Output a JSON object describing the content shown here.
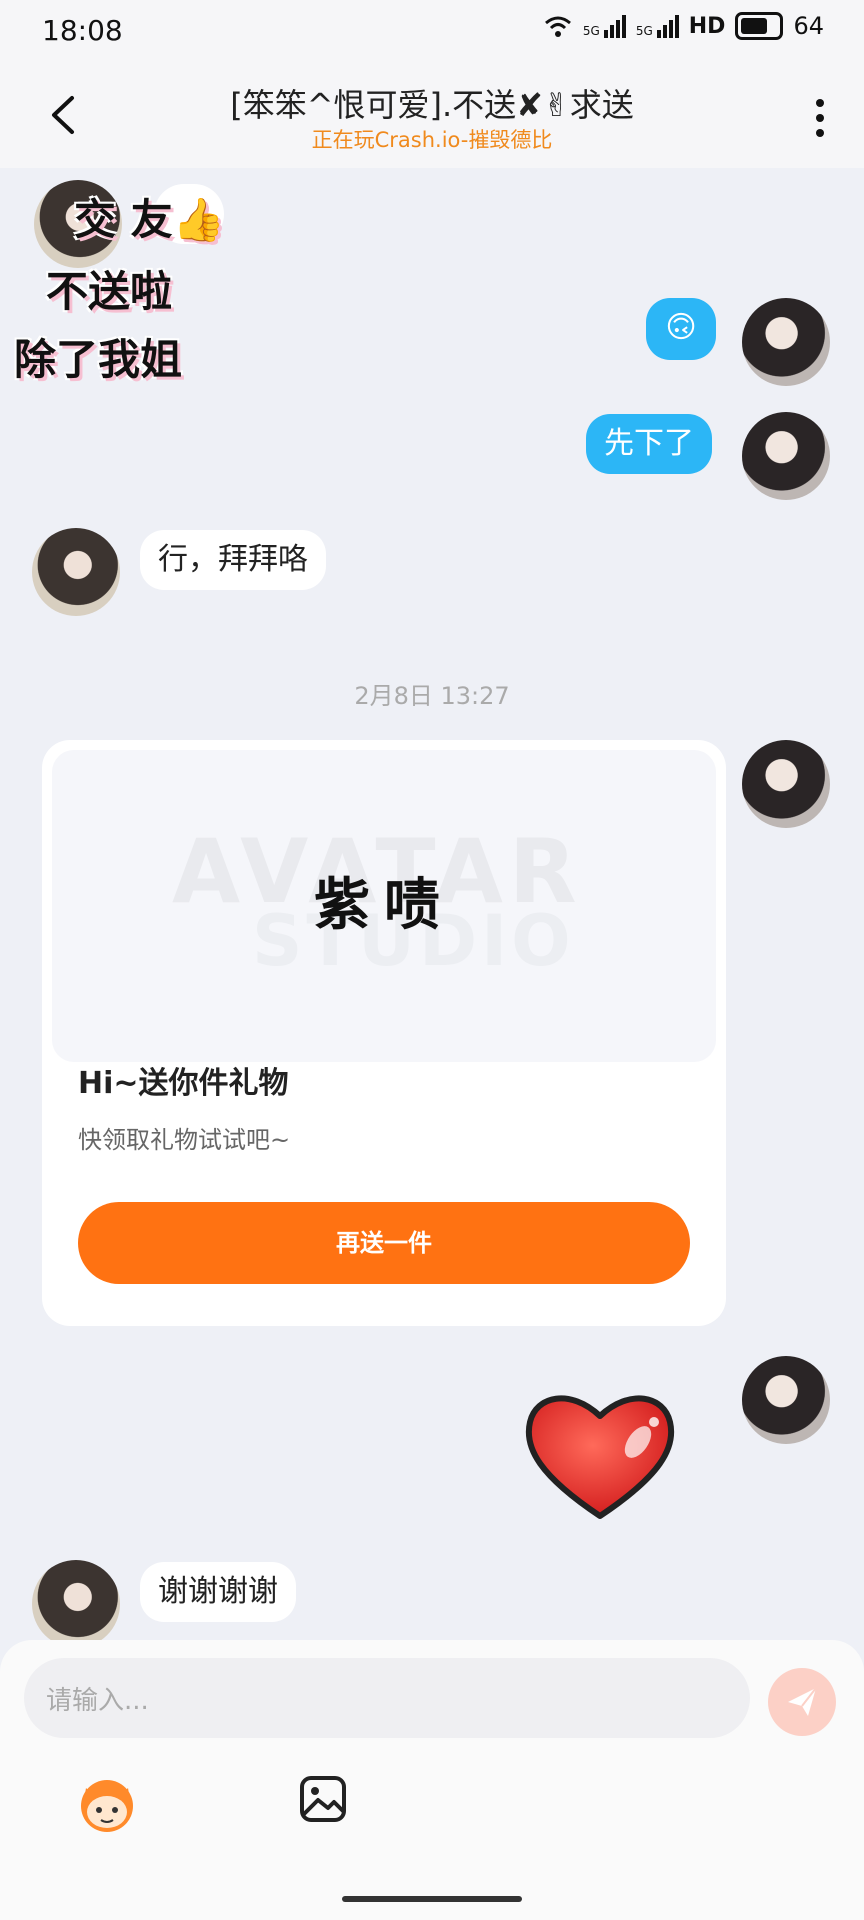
{
  "status_bar": {
    "time": "18:08",
    "network_1": "5G",
    "network_2": "5G",
    "hd": "HD",
    "battery": "64"
  },
  "header": {
    "title": "[笨笨^恨可爱].不送✘✌求送",
    "subtitle": "正在玩Crash.io-摧毁德比"
  },
  "sticker": {
    "line1": "交 友👍",
    "line2": "不送啦",
    "line3": "除了我姐"
  },
  "messages": {
    "emoji_reply": "🙃",
    "out_bye": "先下了",
    "in_bye": "行，拜拜咯",
    "in_thanks": "谢谢谢谢"
  },
  "timestamp": "2月8日 13:27",
  "gift_card": {
    "image_title": "紫啧",
    "title": "Hi~送你件礼物",
    "description": "快领取礼物试试吧~",
    "button_label": "再送一件"
  },
  "input": {
    "placeholder": "请输入..."
  },
  "colors": {
    "accent_orange": "#ff7212",
    "bubble_blue": "#2cb6f6",
    "subtitle_orange": "#f08a1d"
  }
}
